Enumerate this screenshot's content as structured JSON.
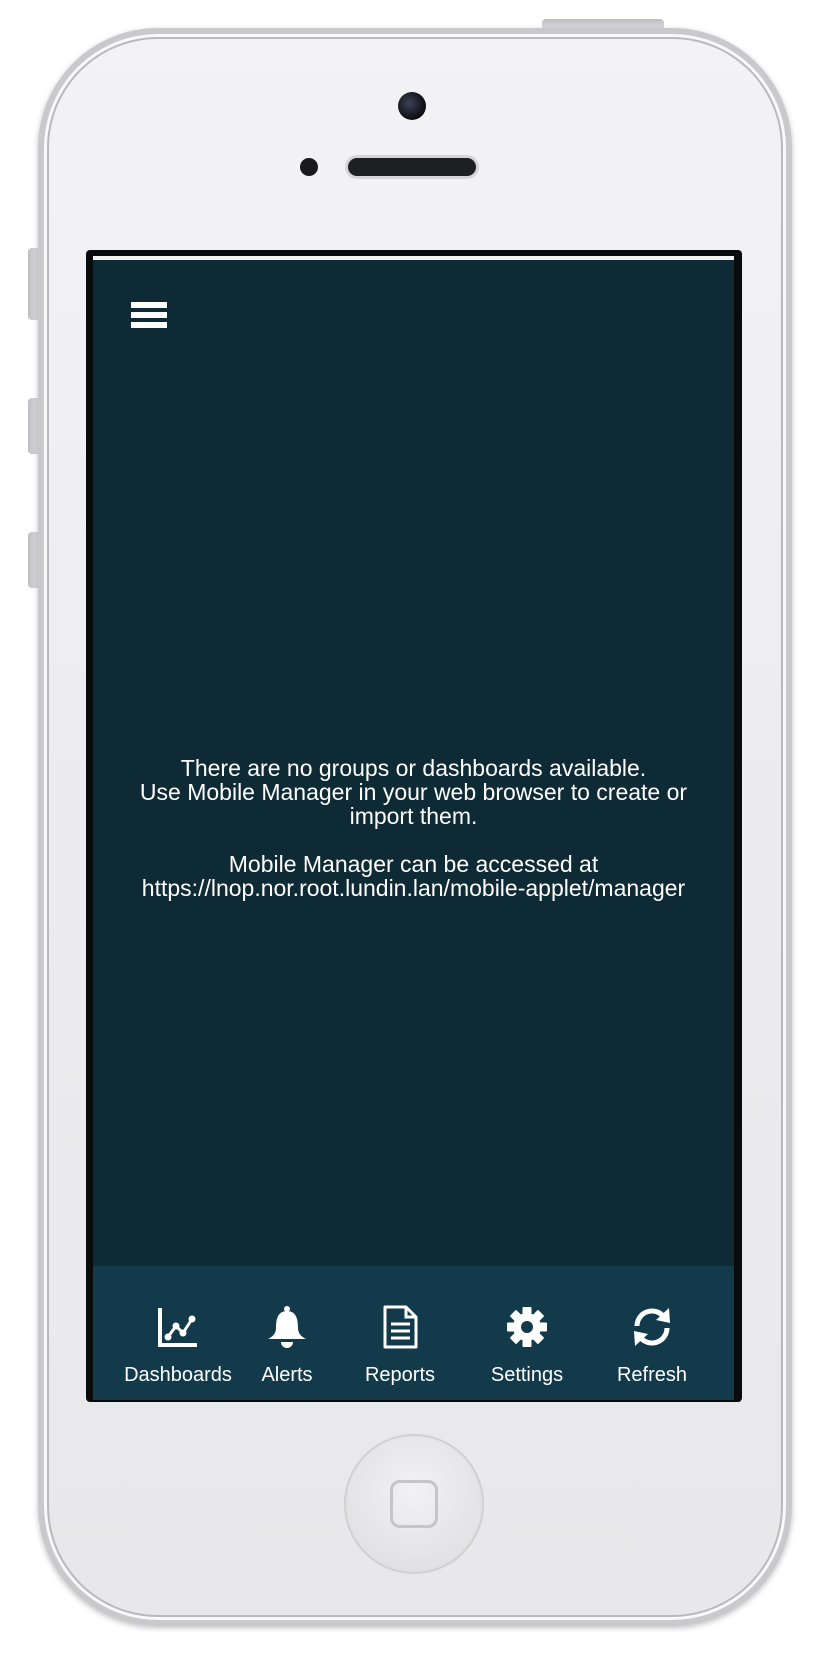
{
  "screen": {
    "background_color": "#0e2a35",
    "message_lines": [
      "There are no groups or dashboards available.",
      "Use Mobile Manager in your web browser to create or",
      "import them."
    ],
    "access_lines": [
      "Mobile Manager can be accessed at",
      "https://lnop.nor.root.lundin.lan/mobile-applet/manager"
    ]
  },
  "menu": {
    "icon": "hamburger-menu-icon"
  },
  "tabbar": {
    "background_color": "#123a4b",
    "tabs": [
      {
        "label": "Dashboards",
        "icon": "line-chart-icon"
      },
      {
        "label": "Alerts",
        "icon": "bell-icon"
      },
      {
        "label": "Reports",
        "icon": "document-icon"
      },
      {
        "label": "Settings",
        "icon": "gear-icon"
      },
      {
        "label": "Refresh",
        "icon": "refresh-icon"
      }
    ]
  }
}
